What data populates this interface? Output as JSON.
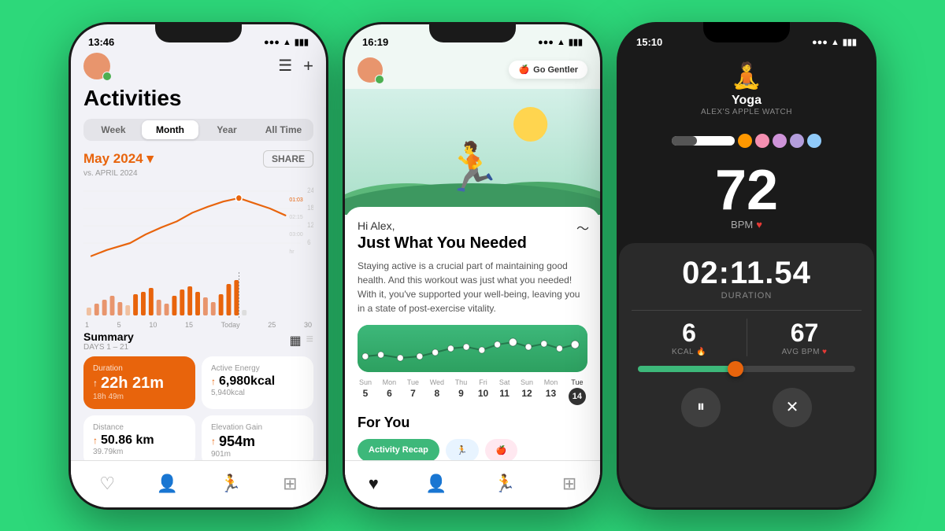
{
  "background": "#2dd87a",
  "phone1": {
    "status_time": "13:46",
    "header": {
      "title": "Activities"
    },
    "tabs": [
      "Week",
      "Month",
      "Year",
      "All Time"
    ],
    "active_tab": "Month",
    "month": "May 2024",
    "vs": "vs. APRIL 2024",
    "share_label": "SHARE",
    "axis_labels": [
      "1",
      "5",
      "10",
      "15",
      "Today",
      "25",
      "30"
    ],
    "summary_title": "Summary",
    "summary_days": "DAYS 1 – 21",
    "stats": [
      {
        "label": "Duration",
        "value": "22h 21m",
        "sub": "18h 49m",
        "orange": true
      },
      {
        "label": "Active Energy",
        "value": "6,980kcal",
        "sub": "5,940kcal",
        "orange": false
      },
      {
        "label": "Distance",
        "value": "50.86 km",
        "sub": "39.79km",
        "orange": false
      },
      {
        "label": "Elevation Gain",
        "value": "954m",
        "sub": "901m",
        "orange": false
      }
    ]
  },
  "phone2": {
    "status_time": "16:19",
    "go_gentler": "Go Gentler",
    "greeting": "Hi Alex,",
    "title": "Just What You Needed",
    "body": "Staying active is a crucial part of maintaining good health. And this workout was just what you needed! With it, you've supported your well-being, leaving you in a state of post-exercise vitality.",
    "week_days": [
      "Sun",
      "Mon",
      "Tue",
      "Wed",
      "Thu",
      "Fri",
      "Sat",
      "Sun",
      "Mon",
      "Tue"
    ],
    "week_nums": [
      "5",
      "6",
      "7",
      "8",
      "9",
      "10",
      "11",
      "12",
      "13",
      "14"
    ],
    "active_day_index": 9,
    "for_you": "For You",
    "chips": [
      "Activity Recap",
      "🏃 Running",
      "🍎 Nutrition"
    ]
  },
  "phone3": {
    "status_time": "15:10",
    "workout_name": "Yoga",
    "watch_label": "ALEX'S APPLE WATCH",
    "bpm": "72",
    "bpm_label": "BPM",
    "duration": "02:11.54",
    "duration_label": "DURATION",
    "kcal": "6",
    "kcal_label": "KCAL",
    "avg_bpm": "67",
    "avg_bpm_label": "AVG BPM",
    "swatches": [
      "#ff9800",
      "#f48fb1",
      "#ce93d8",
      "#b39ddb",
      "#90caf9"
    ],
    "slider_percent": 45
  }
}
